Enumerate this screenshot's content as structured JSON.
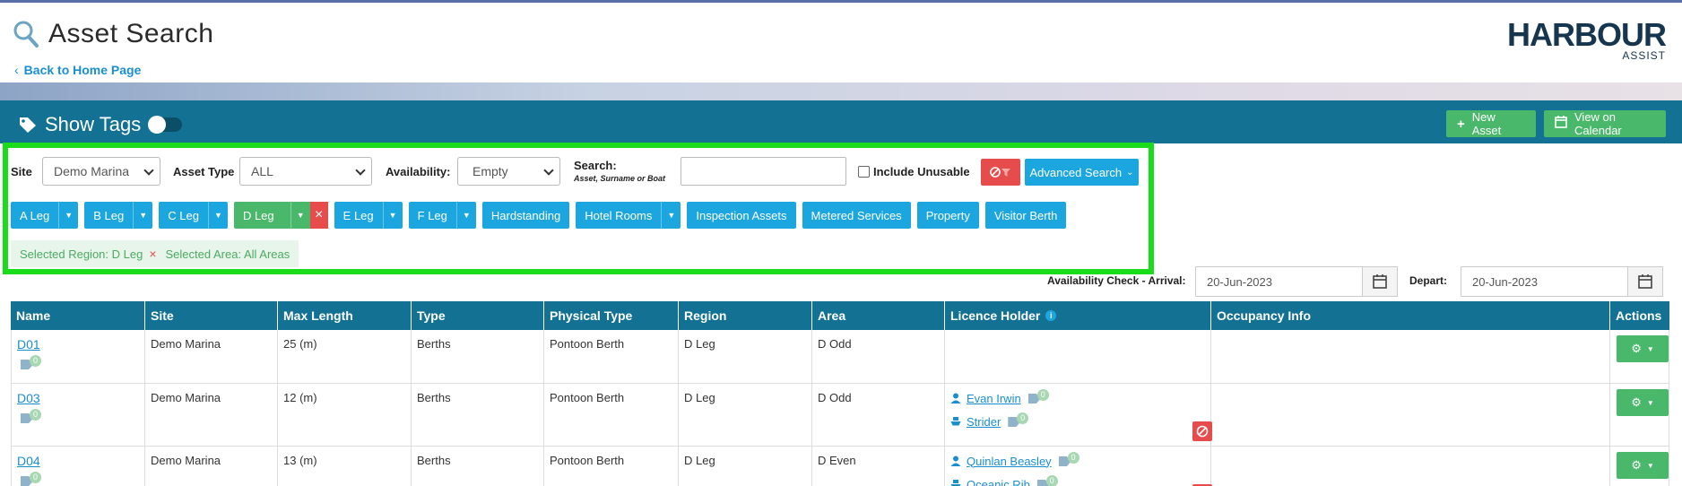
{
  "header": {
    "title": "Asset Search",
    "back_link": "Back to Home Page",
    "logo_brand": "HARBOUR",
    "logo_sub": "ASSIST"
  },
  "toolbar": {
    "show_tags_label": "Show Tags",
    "show_tags_on": false,
    "new_asset_label": "New Asset",
    "view_calendar_label": "View on Calendar"
  },
  "filters": {
    "site_label": "Site",
    "site_value": "Demo Marina",
    "asset_type_label": "Asset Type",
    "asset_type_value": "ALL",
    "availability_label": "Availability:",
    "availability_value": "Empty",
    "search_label": "Search:",
    "search_hint": "Asset, Surname or Boat",
    "search_value": "",
    "include_unusable_label": "Include Unusable",
    "include_unusable_checked": false,
    "advanced_search_label": "Advanced Search"
  },
  "regions": [
    {
      "label": "A Leg",
      "dropdown": true,
      "active": false
    },
    {
      "label": "B Leg",
      "dropdown": true,
      "active": false
    },
    {
      "label": "C Leg",
      "dropdown": true,
      "active": false
    },
    {
      "label": "D Leg",
      "dropdown": true,
      "active": true
    },
    {
      "label": "E Leg",
      "dropdown": true,
      "active": false
    },
    {
      "label": "F Leg",
      "dropdown": true,
      "active": false
    },
    {
      "label": "Hardstanding",
      "dropdown": false,
      "active": false
    },
    {
      "label": "Hotel Rooms",
      "dropdown": true,
      "active": false
    },
    {
      "label": "Inspection Assets",
      "dropdown": false,
      "active": false
    },
    {
      "label": "Metered Services",
      "dropdown": false,
      "active": false
    },
    {
      "label": "Property",
      "dropdown": false,
      "active": false
    },
    {
      "label": "Visitor Berth",
      "dropdown": false,
      "active": false
    }
  ],
  "selection": {
    "region_text": "Selected Region: D Leg",
    "area_text": "Selected Area: All Areas"
  },
  "dates": {
    "availability_check_label": "Availability Check - Arrival:",
    "arrival_value": "20-Jun-2023",
    "depart_label": "Depart:",
    "depart_value": "20-Jun-2023"
  },
  "table": {
    "columns": [
      "Name",
      "Site",
      "Max Length",
      "Type",
      "Physical Type",
      "Region",
      "Area",
      "Licence Holder",
      "Occupancy Info",
      "Actions"
    ],
    "rows": [
      {
        "name": "D01",
        "tags": "0",
        "site": "Demo Marina",
        "max_length": "25 (m)",
        "type": "Berths",
        "physical_type": "Pontoon Berth",
        "region": "D Leg",
        "area": "D Odd",
        "holders": []
      },
      {
        "name": "D03",
        "tags": "0",
        "site": "Demo Marina",
        "max_length": "12 (m)",
        "type": "Berths",
        "physical_type": "Pontoon Berth",
        "region": "D Leg",
        "area": "D Odd",
        "holders": [
          {
            "kind": "person",
            "name": "Evan Irwin",
            "tags": "0"
          },
          {
            "kind": "boat",
            "name": "Strider",
            "tags": "0"
          }
        ]
      },
      {
        "name": "D04",
        "tags": "0",
        "site": "Demo Marina",
        "max_length": "13 (m)",
        "type": "Berths",
        "physical_type": "Pontoon Berth",
        "region": "D Leg",
        "area": "D Even",
        "holders": [
          {
            "kind": "person",
            "name": "Quinlan Beasley",
            "tags": "0"
          },
          {
            "kind": "boat",
            "name": "Oceanic Rib",
            "tags": "0"
          }
        ]
      }
    ]
  },
  "colors": {
    "toolbar": "#137294",
    "primary": "#1ca6e0",
    "success": "#49b86a",
    "danger": "#e74c4c",
    "highlight": "#1bdc1b"
  }
}
